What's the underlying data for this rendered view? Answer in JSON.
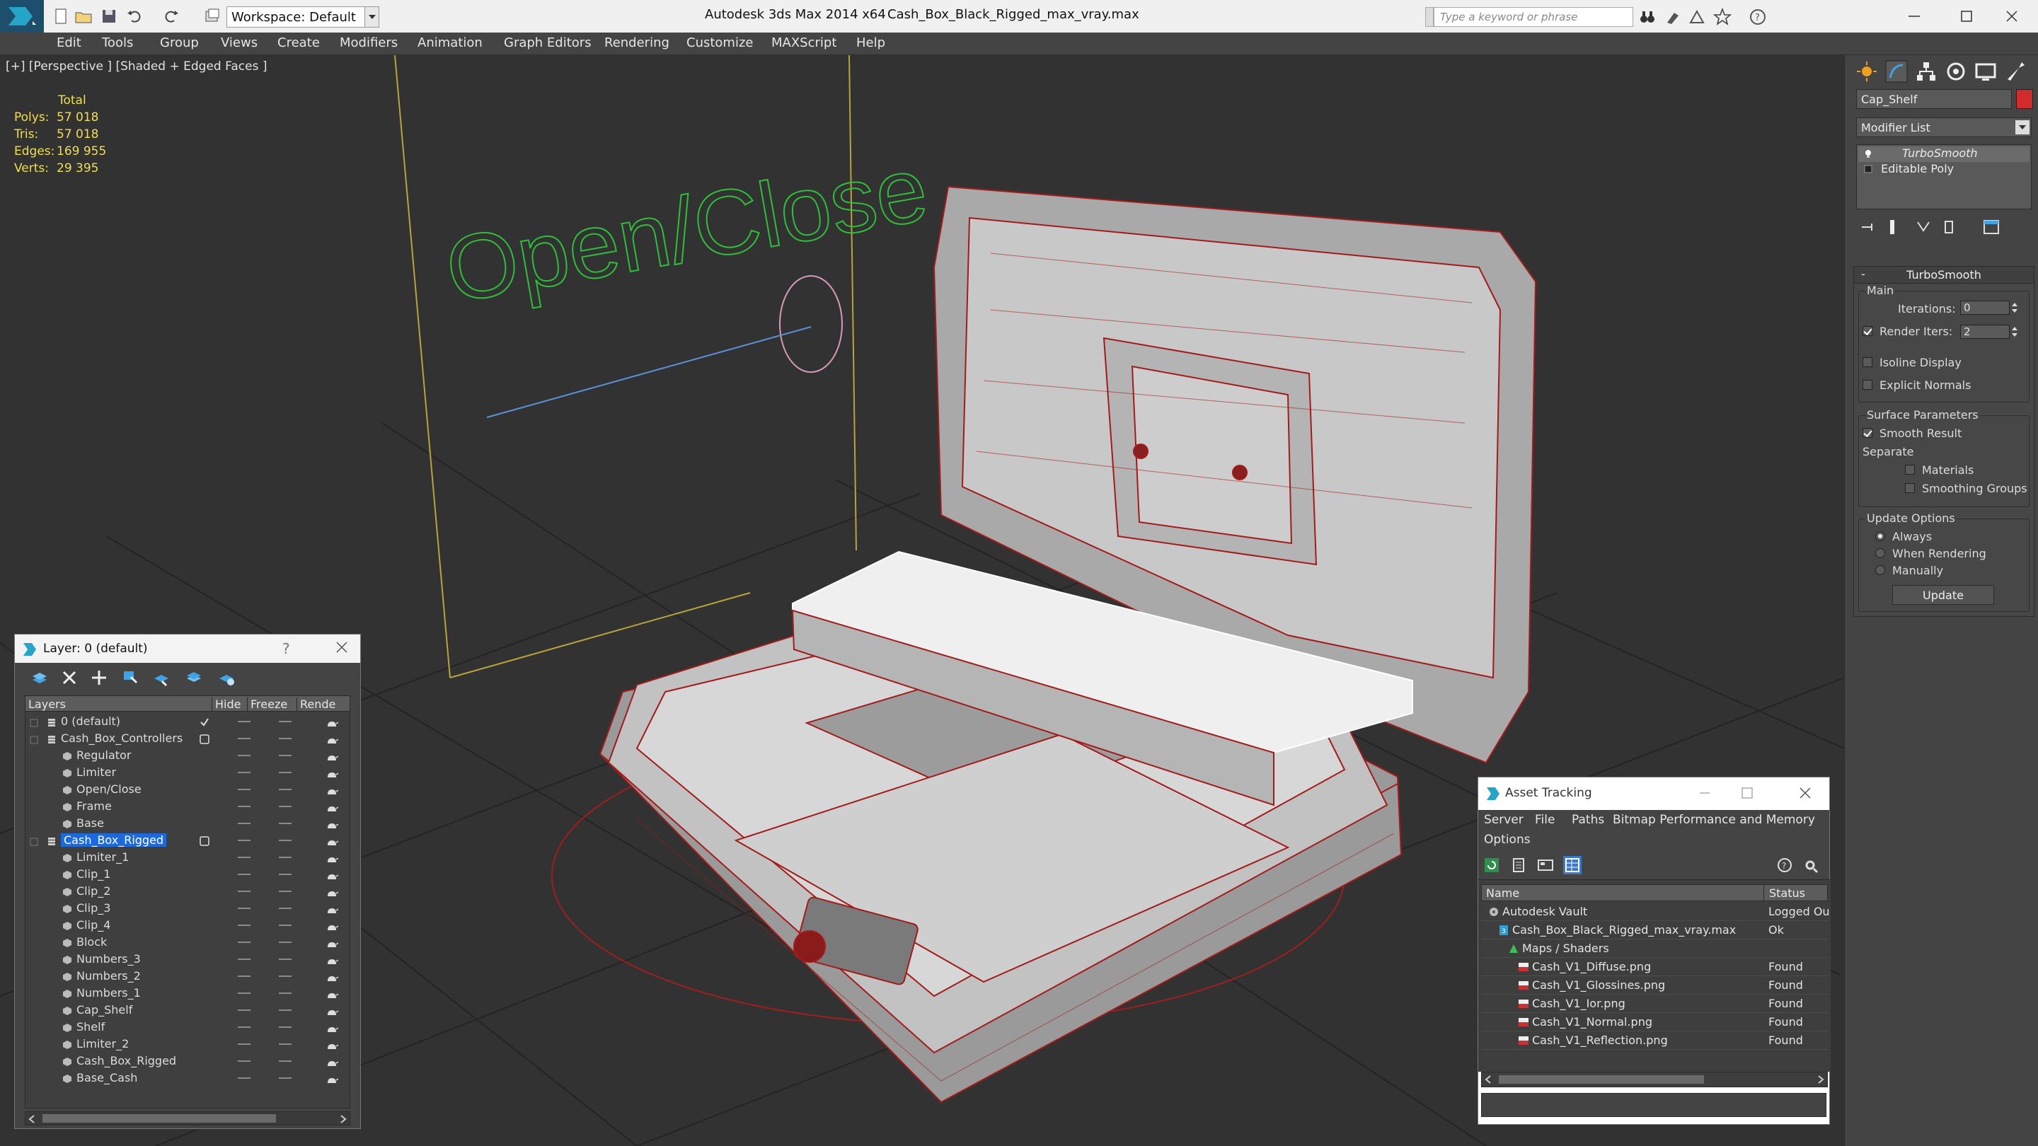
{
  "title_bar": {
    "workspace": "Workspace: Default",
    "app_title": "Autodesk 3ds Max  2014 x64",
    "file_title": "Cash_Box_Black_Rigged_max_vray.max",
    "search_placeholder": "Type a keyword or phrase"
  },
  "menu": [
    "Edit",
    "Tools",
    "Group",
    "Views",
    "Create",
    "Modifiers",
    "Animation",
    "Graph Editors",
    "Rendering",
    "Customize",
    "MAXScript",
    "Help"
  ],
  "viewport": {
    "label": "[+] [Perspective ] [Shaded + Edged Faces ]",
    "overlay_text": "Open/Close",
    "stats": {
      "total_label": "Total",
      "rows": [
        {
          "label": "Polys:",
          "value": "57 018"
        },
        {
          "label": "Tris:",
          "value": "57 018"
        },
        {
          "label": "Edges:",
          "value": "169 955"
        },
        {
          "label": "Verts:",
          "value": "29 395"
        }
      ]
    }
  },
  "command_panel": {
    "object_name": "Cap_Shelf",
    "object_color": "#d22b2b",
    "modifier_list": "Modifier List",
    "stack": [
      "TurboSmooth",
      "Editable Poly"
    ],
    "rollout_title": "TurboSmooth",
    "main_group": "Main",
    "iterations_label": "Iterations:",
    "iterations_value": "0",
    "render_iters_label": "Render Iters:",
    "render_iters_value": "2",
    "isoline_label": "Isoline Display",
    "explicit_normals_label": "Explicit Normals",
    "surface_group": "Surface Parameters",
    "smooth_result_label": "Smooth Result",
    "separate_label": "Separate",
    "materials_label": "Materials",
    "smoothing_groups_label": "Smoothing Groups",
    "update_group": "Update Options",
    "always_label": "Always",
    "when_rendering_label": "When Rendering",
    "manually_label": "Manually",
    "update_button": "Update"
  },
  "layer_explorer": {
    "title": "Layer: 0 (default)",
    "help": "?",
    "columns": [
      "Layers",
      "Hide",
      "Freeze",
      "Rende"
    ],
    "rows": [
      {
        "name": "0 (default)",
        "indent": 1,
        "type": "layer",
        "mark": "check"
      },
      {
        "name": "Cash_Box_Controllers",
        "indent": 1,
        "type": "layer",
        "mark": "box"
      },
      {
        "name": "Regulator",
        "indent": 2,
        "type": "object"
      },
      {
        "name": "Limiter",
        "indent": 2,
        "type": "object"
      },
      {
        "name": "Open/Close",
        "indent": 2,
        "type": "object"
      },
      {
        "name": "Frame",
        "indent": 2,
        "type": "object"
      },
      {
        "name": "Base",
        "indent": 2,
        "type": "object"
      },
      {
        "name": "Cash_Box_Rigged",
        "indent": 1,
        "type": "layer",
        "mark": "box",
        "selected": true
      },
      {
        "name": "Limiter_1",
        "indent": 2,
        "type": "object"
      },
      {
        "name": "Clip_1",
        "indent": 2,
        "type": "object"
      },
      {
        "name": "Clip_2",
        "indent": 2,
        "type": "object"
      },
      {
        "name": "Clip_3",
        "indent": 2,
        "type": "object"
      },
      {
        "name": "Clip_4",
        "indent": 2,
        "type": "object"
      },
      {
        "name": "Block",
        "indent": 2,
        "type": "object"
      },
      {
        "name": "Numbers_3",
        "indent": 2,
        "type": "object"
      },
      {
        "name": "Numbers_2",
        "indent": 2,
        "type": "object"
      },
      {
        "name": "Numbers_1",
        "indent": 2,
        "type": "object"
      },
      {
        "name": "Cap_Shelf",
        "indent": 2,
        "type": "object"
      },
      {
        "name": "Shelf",
        "indent": 2,
        "type": "object"
      },
      {
        "name": "Limiter_2",
        "indent": 2,
        "type": "object"
      },
      {
        "name": "Cash_Box_Rigged",
        "indent": 2,
        "type": "object"
      },
      {
        "name": "Base_Cash",
        "indent": 2,
        "type": "object"
      }
    ]
  },
  "asset_tracking": {
    "title": "Asset Tracking",
    "menu_row1": [
      "Server",
      "File",
      "Paths",
      "Bitmap Performance and Memory"
    ],
    "menu_row2": [
      "Options"
    ],
    "columns": [
      "Name",
      "Status"
    ],
    "rows": [
      {
        "name": "Autodesk Vault",
        "status": "Logged Ou",
        "indent": 0,
        "icon": "vault"
      },
      {
        "name": "Cash_Box_Black_Rigged_max_vray.max",
        "status": "Ok",
        "indent": 1,
        "icon": "max"
      },
      {
        "name": "Maps / Shaders",
        "status": "",
        "indent": 2,
        "icon": "maps"
      },
      {
        "name": "Cash_V1_Diffuse.png",
        "status": "Found",
        "indent": 3,
        "icon": "png"
      },
      {
        "name": "Cash_V1_Glossines.png",
        "status": "Found",
        "indent": 3,
        "icon": "png"
      },
      {
        "name": "Cash_V1_Ior.png",
        "status": "Found",
        "indent": 3,
        "icon": "png"
      },
      {
        "name": "Cash_V1_Normal.png",
        "status": "Found",
        "indent": 3,
        "icon": "png"
      },
      {
        "name": "Cash_V1_Reflection.png",
        "status": "Found",
        "indent": 3,
        "icon": "png"
      }
    ]
  }
}
